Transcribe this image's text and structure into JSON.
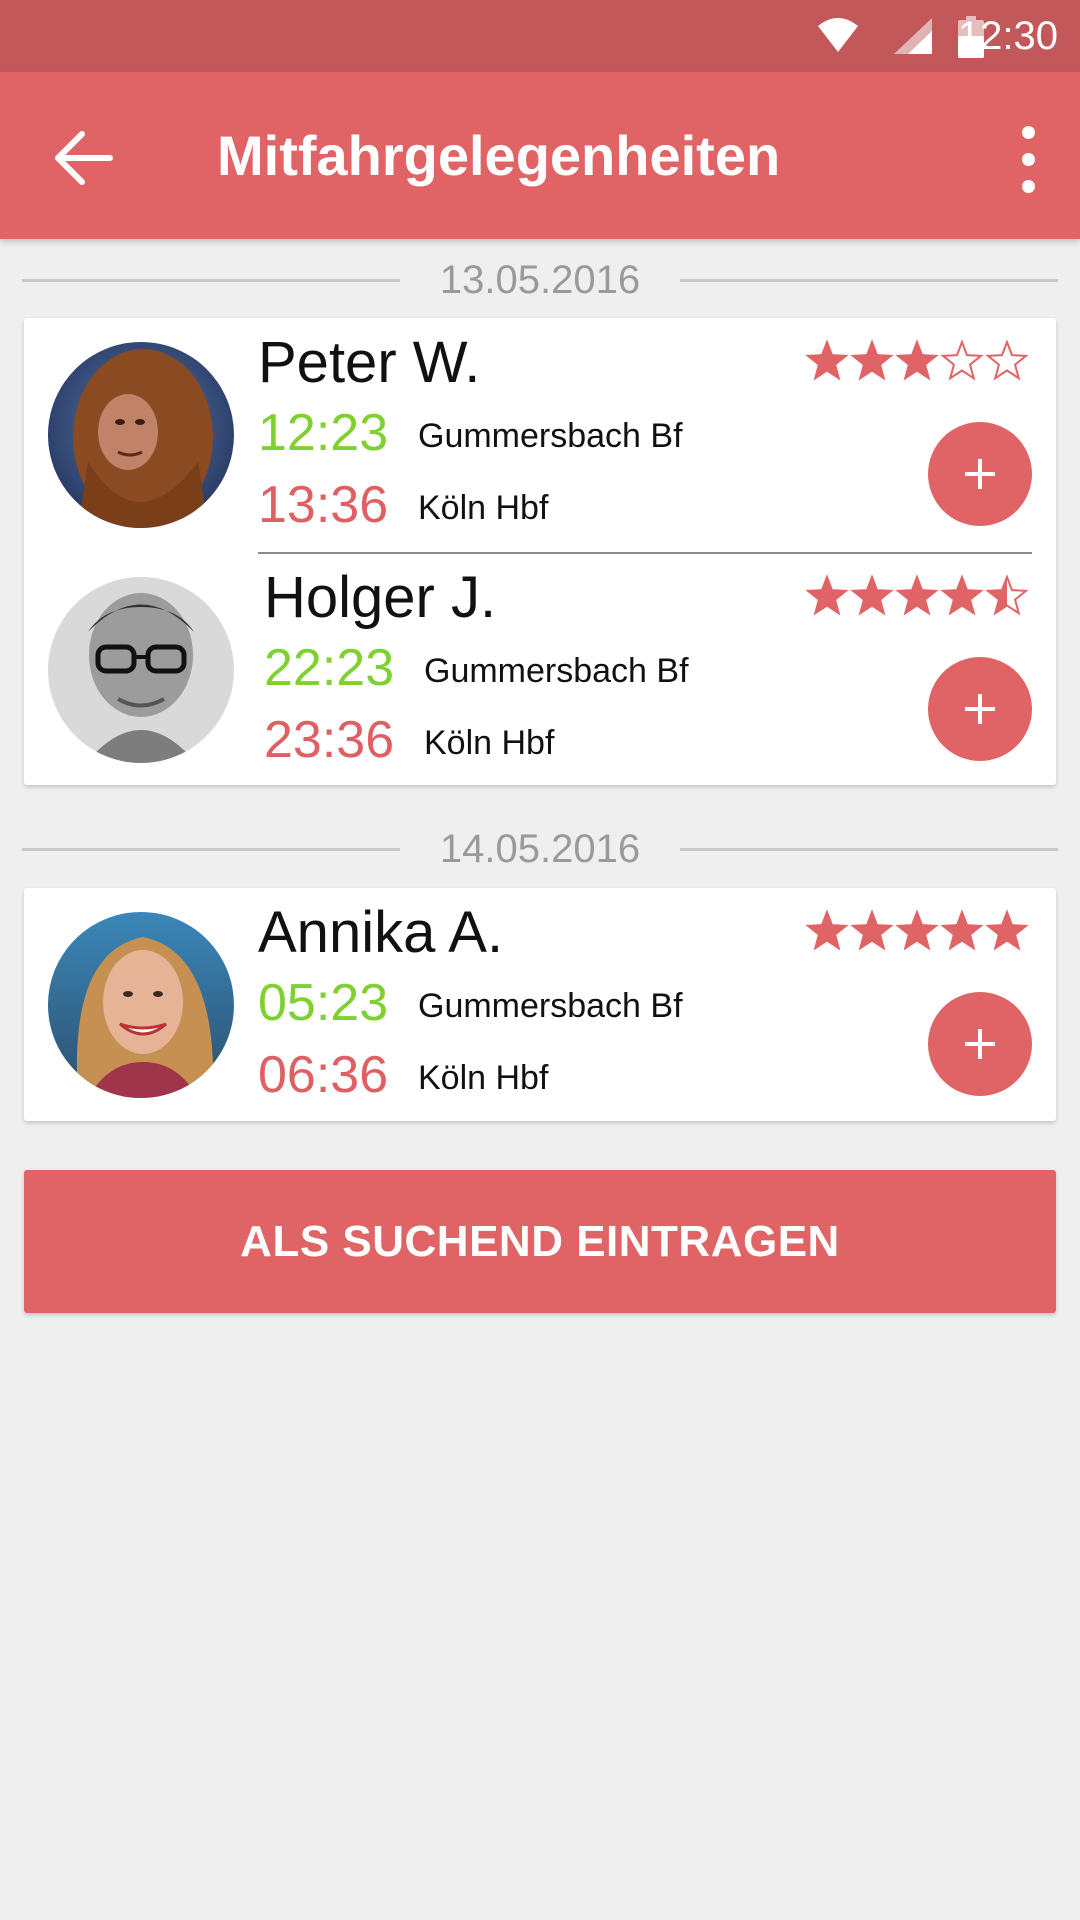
{
  "status_bar": {
    "time": "12:30",
    "icons": [
      "wifi-icon",
      "cell-signal-icon",
      "battery-icon"
    ]
  },
  "app_bar": {
    "title": "Mitfahrgelegenheiten",
    "back_icon": "arrow-back-icon",
    "menu_icon": "more-vert-icon"
  },
  "colors": {
    "primary": "#e06466",
    "status_bar": "#c2585a",
    "departure_time": "#7ed12f",
    "arrival_time": "#df6062",
    "background": "#efefef"
  },
  "groups": [
    {
      "date": "13.05.2016",
      "rides": [
        {
          "name": "Peter W.",
          "rating": 3,
          "departure_time": "12:23",
          "departure_place": "Gummersbach Bf",
          "arrival_time": "13:36",
          "arrival_place": "Köln Hbf",
          "avatar": "photo-avatar"
        },
        {
          "name": "Holger J.",
          "rating": 4.5,
          "departure_time": "22:23",
          "departure_place": "Gummersbach Bf",
          "arrival_time": "23:36",
          "arrival_place": "Köln Hbf",
          "avatar": "photo-avatar"
        }
      ]
    },
    {
      "date": "14.05.2016",
      "rides": [
        {
          "name": "Annika A.",
          "rating": 5,
          "departure_time": "05:23",
          "departure_place": "Gummersbach Bf",
          "arrival_time": "06:36",
          "arrival_place": "Köln Hbf",
          "avatar": "photo-avatar"
        }
      ]
    }
  ],
  "cta_label": "ALS SUCHEND EINTRAGEN"
}
